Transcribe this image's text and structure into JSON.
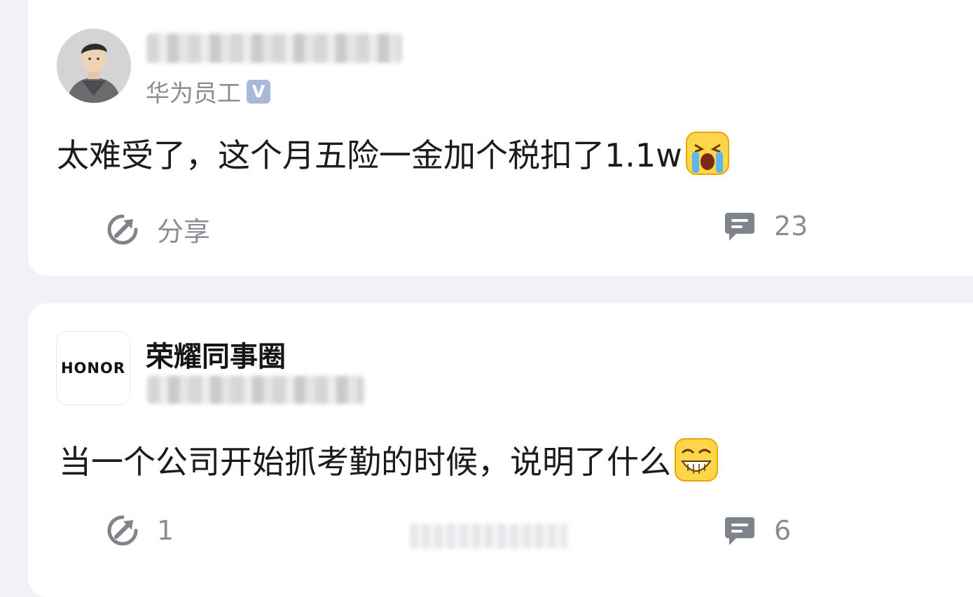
{
  "posts": [
    {
      "author_subtitle": "华为员工",
      "verified_badge": "V",
      "content": "太难受了，这个月五险一金加个税扣了1.1w",
      "emoji_icon": "crying-face-icon",
      "share_label": "分享",
      "comment_count": "23"
    },
    {
      "group_name": "荣耀同事圈",
      "logo_text": "HONOR",
      "content": "当一个公司开始抓考勤的时候，说明了什么",
      "emoji_icon": "grinning-face-icon",
      "share_count": "1",
      "comment_count": "6"
    }
  ],
  "colors": {
    "background": "#f1f2f6",
    "card": "#ffffff",
    "muted_text": "#8a8d95",
    "icon_gray": "#7f838c",
    "badge": "#a9b8d8"
  }
}
